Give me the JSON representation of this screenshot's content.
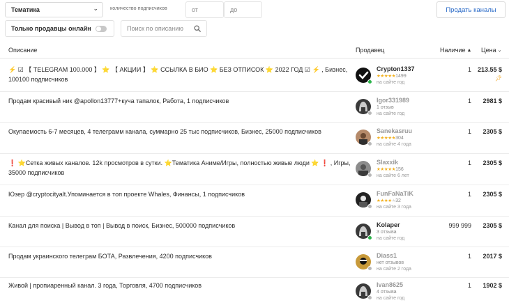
{
  "filters": {
    "category_value": "Тематика",
    "subscribers_label": "количество подписчиков",
    "from_placeholder": "от",
    "to_placeholder": "до",
    "sell_button": "Продать каналы",
    "sellers_online_label": "Только продавцы онлайн",
    "search_placeholder": "Поиск по описанию"
  },
  "table": {
    "headers": {
      "description": "Описание",
      "seller": "Продавец",
      "availability": "Наличие",
      "price": "Цена"
    },
    "rows": [
      {
        "description": "⚡ ☑ 【 TELEGRAM 100.000 】 ⭐ 【 АКЦИИ 】 ⭐ ССЫЛКА В БИО ⭐ БЕЗ ОТПИСОК ⭐ 2022 ГОД ☑ ⚡ , Бизнес, 100100 подписчиков",
        "seller_name": "Crypton1337",
        "seller_reviews": "1499",
        "seller_seen": "на сайте год",
        "qty": "1",
        "price": "213.55 $"
      },
      {
        "description": "Продам красивый ник @apollon13777+куча тапалок, Работа, 1 подписчиков",
        "seller_name": "Igor331989",
        "seller_reviews": "1 отзыв",
        "seller_seen": "на сайте год",
        "qty": "1",
        "price": "2981 $"
      },
      {
        "description": "Окупаемость 6-7 месяцев, 4 телеграмм канала, суммарно 25 тыс подписчиков, Бизнес, 25000 подписчиков",
        "seller_name": "Sanekasruu",
        "seller_reviews": "304",
        "seller_seen": "на сайте 4 года",
        "qty": "1",
        "price": "2305 $"
      },
      {
        "description": "❗ ⭐Сетка живых каналов. 12k просмотров в сутки. ⭐Тематика Аниме/Игры, полностью живые люди ⭐ ❗ , Игры, 35000 подписчиков",
        "seller_name": "Slaxxik",
        "seller_reviews": "156",
        "seller_seen": "на сайте 6 лет",
        "qty": "1",
        "price": "2305 $"
      },
      {
        "description": "Юзер @cryptocityalt.Упоминается в топ проекте Whales, Финансы, 1 подписчиков",
        "seller_name": "FunFaNaTiK",
        "seller_reviews": "32",
        "seller_seen": "на сайте 3 года",
        "qty": "1",
        "price": "2305 $"
      },
      {
        "description": "Канал для поиска | Вывод в топ | Вывод в поиск, Бизнес, 500000 подписчиков",
        "seller_name": "Kolaper",
        "seller_reviews": "3 отзыва",
        "seller_seen": "на сайте год",
        "qty": "999 999",
        "price": "2305 $"
      },
      {
        "description": "Продам украинского телеграм БОТА, Развлечения, 4200 подписчиков",
        "seller_name": "Diass1",
        "seller_reviews": "нет отзывов",
        "seller_seen": "на сайте 2 года",
        "qty": "1",
        "price": "2017 $"
      },
      {
        "description": "Живой | пропиаренный канал. 3 года, Торговля, 4700 подписчиков",
        "seller_name": "Ivan8625",
        "seller_reviews": "4 отзыва",
        "seller_seen": "на сайте год",
        "qty": "1",
        "price": "1902 $"
      }
    ]
  },
  "colors": {
    "accent": "#2a6ac7",
    "online": "#2bb34a",
    "offline": "#b8b8b8",
    "star": "#f2b01e"
  },
  "icons": {
    "dropdown": "chevron-down-icon",
    "search": "search-icon",
    "sort": "sort-icon",
    "promoted": "pin-icon"
  }
}
